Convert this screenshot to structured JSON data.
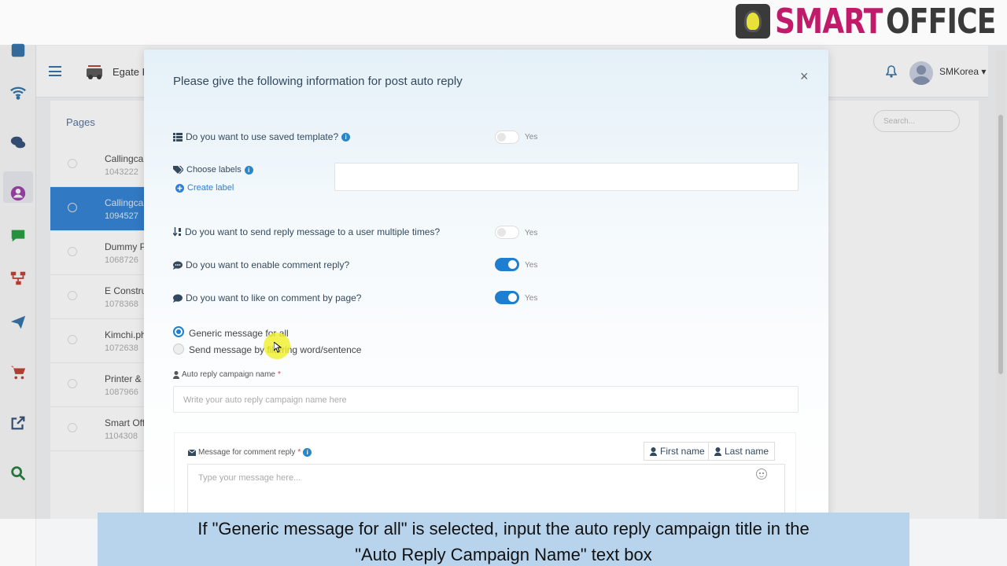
{
  "brand": {
    "smart": "SMART",
    "office": "OFFICE"
  },
  "header": {
    "company": "Egate K",
    "user": "SMKorea ▾"
  },
  "pages_panel": {
    "title": "Pages",
    "search_placeholder": "Search...",
    "rows": [
      {
        "name": "Callingcar",
        "id": "1043222"
      },
      {
        "name": "Callingcar",
        "id": "1094527"
      },
      {
        "name": "Dummy P",
        "id": "1068726"
      },
      {
        "name": "E Constru",
        "id": "1078368"
      },
      {
        "name": "Kimchi.ph",
        "id": "1072638"
      },
      {
        "name": "Printer &",
        "id": "1087966"
      },
      {
        "name": "Smart Off",
        "id": "1104308"
      }
    ]
  },
  "modal": {
    "title": "Please give the following information for post auto reply",
    "close": "×",
    "saved_template": {
      "label": "Do you want to use saved template?",
      "toggle": "Yes",
      "on": false
    },
    "choose_labels": {
      "label": "Choose labels",
      "create": "Create label"
    },
    "multiple_times": {
      "label": "Do you want to send reply message to a user multiple times?",
      "toggle": "Yes",
      "on": false
    },
    "comment_reply": {
      "label": "Do you want to enable comment reply?",
      "toggle": "Yes",
      "on": true
    },
    "like_comment": {
      "label": "Do you want to like on comment by page?",
      "toggle": "Yes",
      "on": true
    },
    "radio_generic": "Generic message for all",
    "radio_filter": "Send message by filtering word/sentence",
    "campaign_name": {
      "label": "Auto reply campaign name",
      "required": "*",
      "placeholder": "Write your auto reply campaign name here"
    },
    "message": {
      "label": "Message for comment reply",
      "required": "*",
      "first_name": "First name",
      "last_name": "Last name",
      "placeholder": "Type your message here..."
    }
  },
  "caption": {
    "line1": "If \"Generic message for all\" is selected, input the auto reply campaign title in the",
    "line2": "\"Auto Reply Campaign Name\" text box"
  },
  "colors": {
    "accent": "#1e7fd0",
    "brand_magenta": "#c21a6b",
    "caption_bg": "#b8d4ec"
  }
}
